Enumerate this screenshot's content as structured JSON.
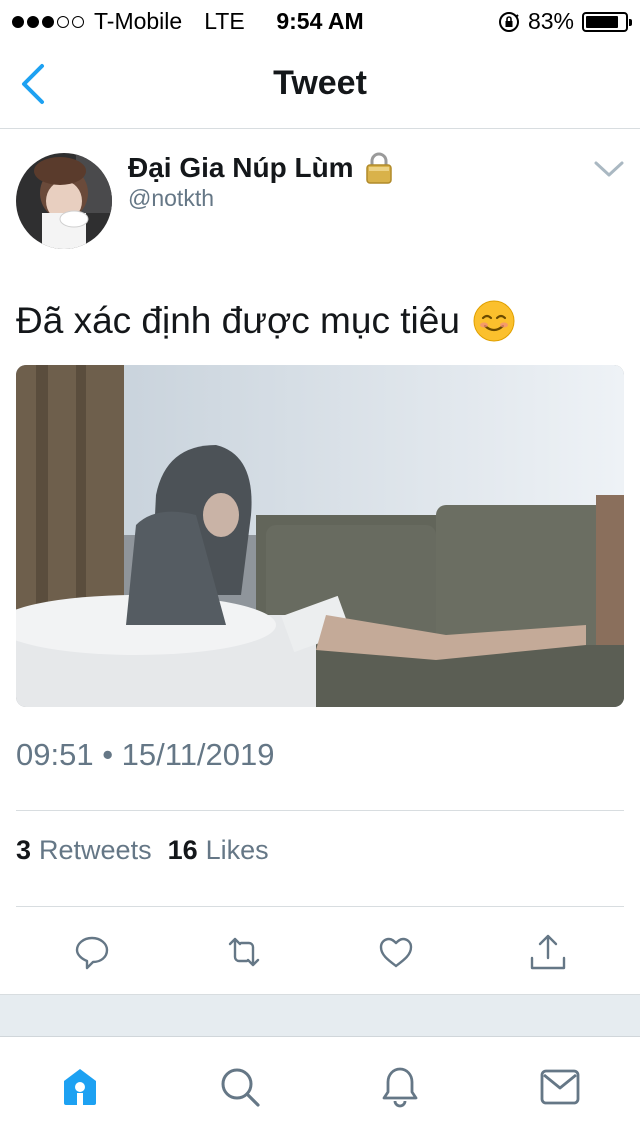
{
  "status_bar": {
    "carrier": "T-Mobile",
    "network": "LTE",
    "time": "9:54 AM",
    "battery": "83%",
    "battery_level": 0.83,
    "signal_bars": 3,
    "signal_total": 5
  },
  "nav": {
    "title": "Tweet",
    "back_icon": "chevron-left-icon"
  },
  "tweet": {
    "display_name": "Đại Gia Núp Lùm",
    "handle": "@notkth",
    "text": "Đã xác định được mục tiêu",
    "timestamp": "09:51 • 15/11/2019",
    "retweets_count": "3",
    "retweets_label": "Retweets",
    "likes_count": "16",
    "likes_label": "Likes"
  },
  "actions": [
    "reply-icon",
    "retweet-icon",
    "like-icon",
    "share-icon"
  ],
  "tabs": [
    "home-icon",
    "search-icon",
    "notifications-icon",
    "messages-icon"
  ],
  "colors": {
    "accent": "#1da1f2",
    "secondary_text": "#657786",
    "icon_gray": "#657786"
  }
}
